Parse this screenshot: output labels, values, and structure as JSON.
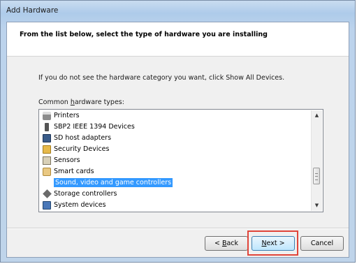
{
  "window": {
    "title": "Add Hardware"
  },
  "header": {
    "text": "From the list below, select the type of hardware you are installing"
  },
  "body": {
    "instruction": "If you do not see the hardware category you want, click Show All Devices.",
    "list_label_before": "Common ",
    "list_label_accel": "h",
    "list_label_after": "ardware types:"
  },
  "list": {
    "items": [
      {
        "label": "Printers",
        "icon": "printer-icon"
      },
      {
        "label": "SBP2 IEEE 1394 Devices",
        "icon": "plug-icon"
      },
      {
        "label": "SD host adapters",
        "icon": "sd-card-icon"
      },
      {
        "label": "Security Devices",
        "icon": "security-device-icon"
      },
      {
        "label": "Sensors",
        "icon": "sensor-icon"
      },
      {
        "label": "Smart cards",
        "icon": "smart-card-icon"
      },
      {
        "label": "Sound, video and game controllers",
        "icon": "speaker-icon",
        "selected": true
      },
      {
        "label": "Storage controllers",
        "icon": "storage-controller-icon"
      },
      {
        "label": "System devices",
        "icon": "system-device-icon"
      }
    ],
    "selected_index": 6
  },
  "buttons": {
    "back_prefix": "< ",
    "back_accel": "B",
    "back_suffix": "ack",
    "next_accel": "N",
    "next_suffix": "ext >",
    "cancel": "Cancel"
  },
  "colors": {
    "selection": "#3399ff",
    "highlight_box": "#e0453a"
  }
}
